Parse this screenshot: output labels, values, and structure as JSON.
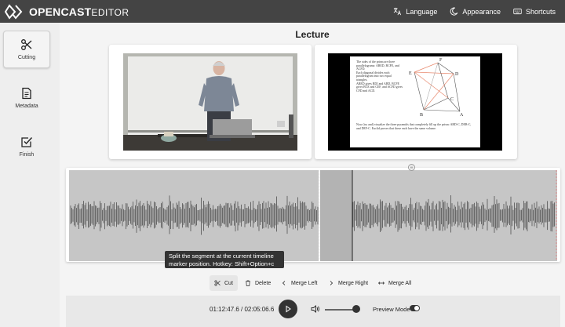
{
  "app": {
    "brand_bold": "OPENCAST",
    "brand_light": "EDITOR"
  },
  "header": {
    "language_label": "Language",
    "appearance_label": "Appearance",
    "shortcuts_label": "Shortcuts"
  },
  "sidebar": {
    "items": [
      {
        "label": "Cutting",
        "icon": "scissors-icon",
        "active": true
      },
      {
        "label": "Metadata",
        "icon": "document-icon",
        "active": false
      },
      {
        "label": "Finish",
        "icon": "checkbox-icon",
        "active": false
      }
    ]
  },
  "main": {
    "title": "Lecture",
    "slide": {
      "text1": "The sides of the prism are three parallelograms: ABED, BCFE, and ACFD.",
      "text2": "Each diagonal divides each parallelogram into two equal triangles.",
      "text3": "ABED gives BDJ and ABD, BCFE gives BCE and CEF, and ACFD gives CFD and ACD.",
      "text4": "Now (try and) visualize the three pyramids that completely fill up the prism: ABD-C, DEB-C, and DEF-C. Euclid proves that these each have the same volume.",
      "labels": [
        "F",
        "E",
        "D",
        "C",
        "B",
        "A"
      ]
    }
  },
  "timeline": {
    "tooltip": "Split the segment at the current timeline marker position. Hotkey: Shift+Option+c"
  },
  "toolbar": {
    "cut_label": "Cut",
    "delete_label": "Delete",
    "merge_left_label": "Merge Left",
    "merge_right_label": "Merge Right",
    "merge_all_label": "Merge All"
  },
  "player": {
    "time": "01:12:47.6 / 02:05:06.6",
    "preview_mode_label": "Preview Mode",
    "volume": 0.9,
    "preview_mode_on": true
  }
}
